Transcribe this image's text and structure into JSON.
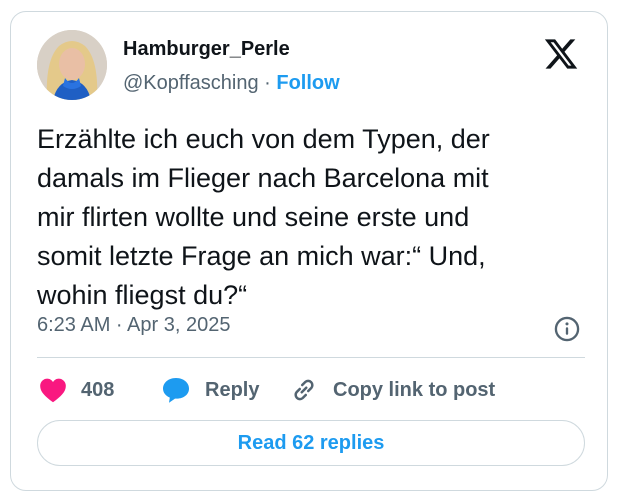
{
  "author": {
    "name": "Hamburger_Perle",
    "handle": "@Kopffasching",
    "separator": "·",
    "follow_label": "Follow"
  },
  "tweet": {
    "lines": [
      "Erzählte ich euch von dem Typen, der",
      "damals im Flieger nach Barcelona mit",
      "mir flirten wollte und seine erste und",
      "somit letzte Frage an mich war:“ Und,",
      "wohin fliegst du?“"
    ],
    "timestamp": "6:23 AM · Apr 3, 2025"
  },
  "actions": {
    "like_count": "408",
    "reply_label": "Reply",
    "copy_label": "Copy link to post"
  },
  "read_replies_label": "Read 62 replies",
  "icons": {
    "brand": "x-logo-icon",
    "info": "info-icon",
    "like": "heart-icon",
    "reply": "speech-bubble-icon",
    "copy": "link-icon"
  },
  "colors": {
    "accent": "#1d9bf0",
    "like": "#f91880",
    "muted": "#536471",
    "border": "#cfd9de",
    "text": "#0f1419"
  }
}
